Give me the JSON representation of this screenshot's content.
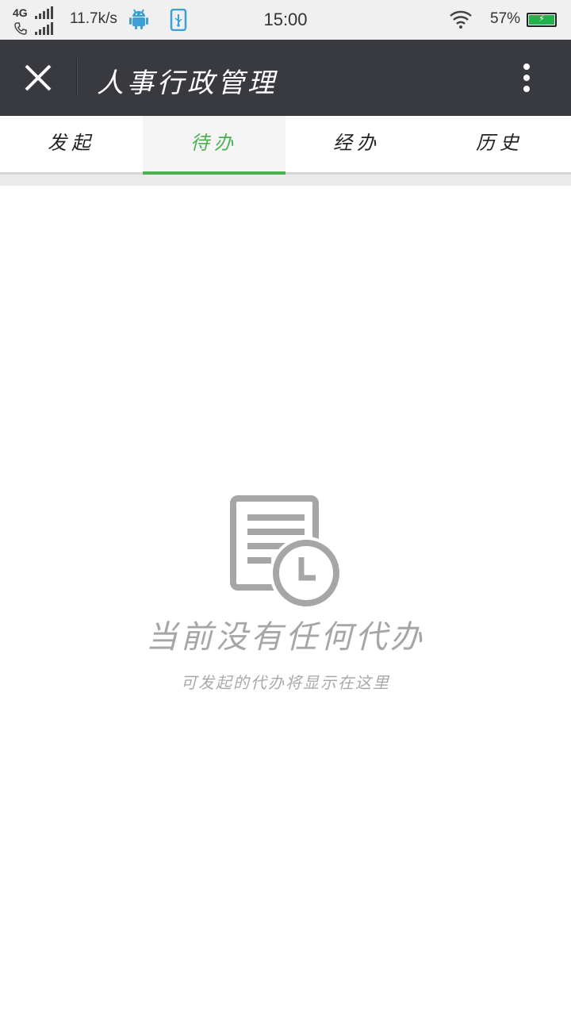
{
  "status_bar": {
    "network": "4G",
    "speed": "11.7k/s",
    "time": "15:00",
    "battery": "57%",
    "icons": [
      "signal-icon",
      "phone-icon",
      "android-icon",
      "usb-icon",
      "wifi-icon",
      "battery-icon"
    ]
  },
  "app_bar": {
    "title": "人事行政管理",
    "close_icon": "close-icon",
    "more_icon": "more-vertical-icon"
  },
  "tabs": [
    {
      "label": "发起",
      "active": false
    },
    {
      "label": "待办",
      "active": true
    },
    {
      "label": "经办",
      "active": false
    },
    {
      "label": "历史",
      "active": false
    }
  ],
  "empty_state": {
    "icon": "document-clock-icon",
    "title": "当前没有任何代办",
    "subtitle": "可发起的代办将显示在这里"
  },
  "colors": {
    "accent": "#4cb050",
    "app_bar_bg": "#393a3f",
    "battery_fill": "#22b14c",
    "empty_icon": "#a6a6a6"
  }
}
